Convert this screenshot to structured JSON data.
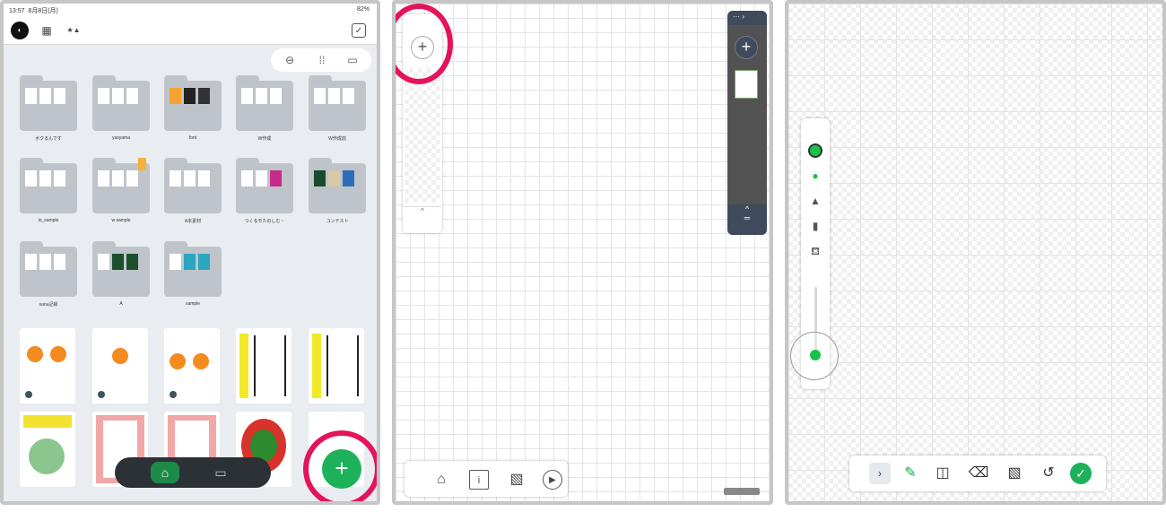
{
  "status": {
    "time": "13:57",
    "date": "8月8日(月)",
    "battery": "82%"
  },
  "library": {
    "folders": [
      {
        "label": "ボクるんです"
      },
      {
        "label": "yasyama"
      },
      {
        "label": "font"
      },
      {
        "label": "W作成"
      },
      {
        "label": "W作成前"
      },
      {
        "label": "io_sample"
      },
      {
        "label": "w sample"
      },
      {
        "label": "A本素材"
      },
      {
        "label": "つくるモたのしむ・"
      },
      {
        "label": "コンテスト"
      },
      {
        "label": "sanu記録"
      },
      {
        "label": "A"
      },
      {
        "label": "sample"
      }
    ],
    "nav": {
      "home_icon": "home-icon",
      "archive_icon": "archive-icon",
      "people_icon": "people-icon"
    },
    "fab_label": "+"
  },
  "canvas_page": {
    "add_label": "+",
    "toolbar": {
      "home_icon": "home-icon",
      "info_icon": "info-icon",
      "layer_icon": "layer-icon",
      "play_icon": "play-icon"
    }
  },
  "draw_page": {
    "tools": [
      "pencil-icon",
      "shape-icon",
      "eraser-icon",
      "layer-icon",
      "history-icon"
    ],
    "check_label": "✓",
    "color": "#19c24d"
  }
}
